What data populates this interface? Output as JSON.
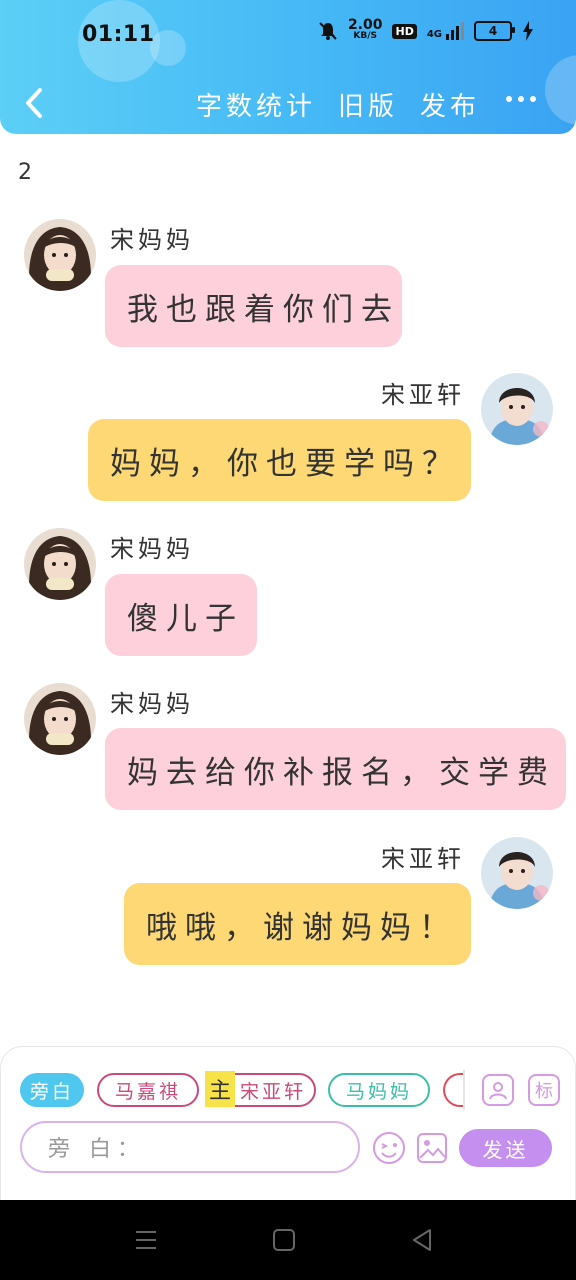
{
  "status_bar": {
    "time": "01:11",
    "net_speed_value": "2.00",
    "net_speed_unit": "KB/S",
    "hd_label": "HD",
    "signal_label": "4G",
    "battery_level": "4"
  },
  "nav": {
    "word_count_label": "字数统计",
    "old_version_label": "旧版",
    "publish_label": "发布"
  },
  "chat": {
    "index": "2",
    "messages": [
      {
        "sender": "宋妈妈",
        "text": "我也跟着你们去",
        "side": "left"
      },
      {
        "sender": "宋亚轩",
        "text": "妈妈，你也要学吗？",
        "side": "right"
      },
      {
        "sender": "宋妈妈",
        "text": "傻儿子",
        "side": "left"
      },
      {
        "sender": "宋妈妈",
        "text": "妈去给你补报名，交学费",
        "side": "left"
      },
      {
        "sender": "宋亚轩",
        "text": "哦哦，谢谢妈妈！",
        "side": "right"
      }
    ]
  },
  "compose": {
    "roles": [
      "旁白",
      "马嘉祺",
      "宋亚轩",
      "马妈妈"
    ],
    "main_badge": "主",
    "tag_button": "标",
    "input_placeholder": "旁 白：",
    "send_label": "发送"
  },
  "colors": {
    "header_gradient_start": "#5ccff6",
    "header_gradient_end": "#3aa3f3",
    "pink_bubble": "#fdd0dc",
    "yellow_bubble": "#fdd874",
    "send_button": "#c48fef",
    "narrator_chip": "#4fc7ef"
  }
}
